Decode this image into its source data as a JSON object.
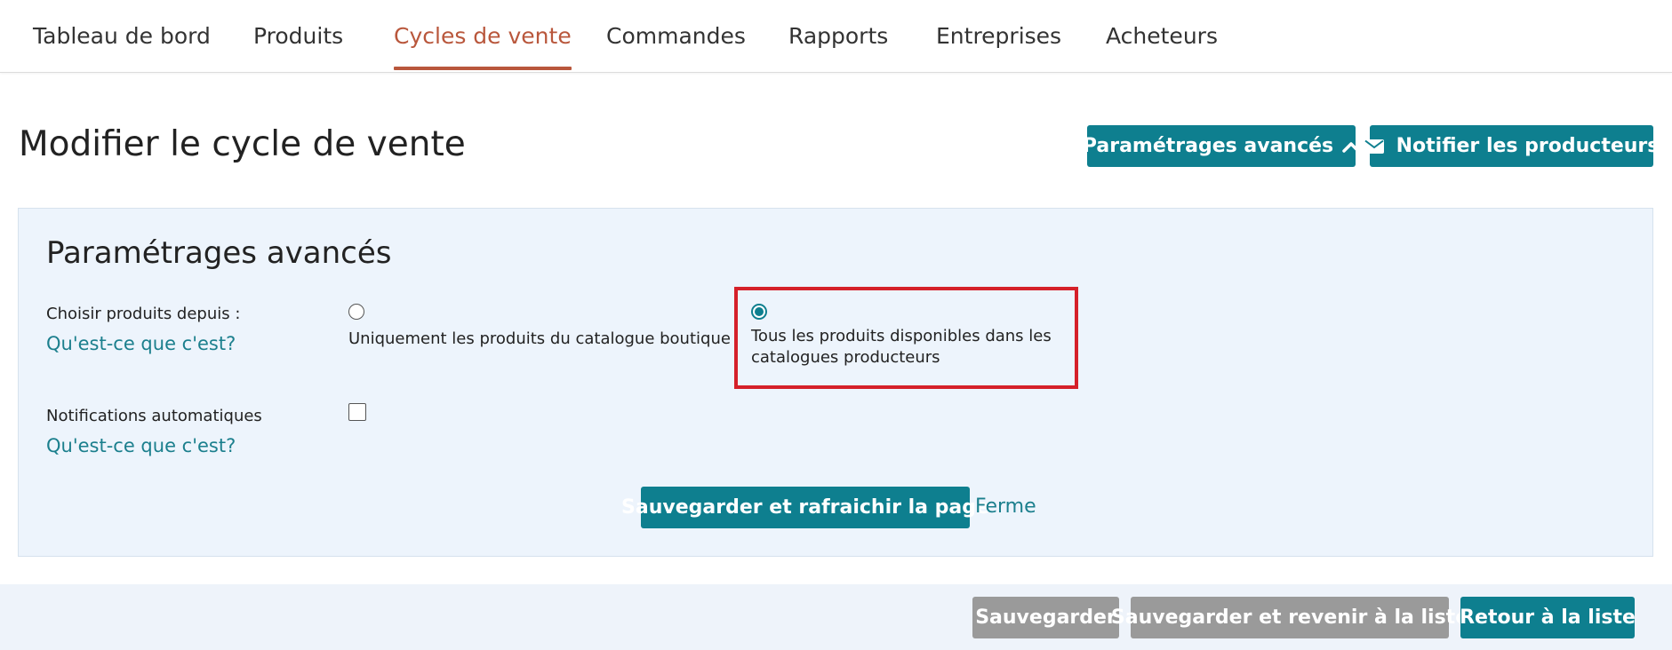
{
  "nav": {
    "tabs": [
      {
        "label": "Tableau de bord"
      },
      {
        "label": "Produits"
      },
      {
        "label": "Cycles de vente"
      },
      {
        "label": "Commandes"
      },
      {
        "label": "Rapports"
      },
      {
        "label": "Entreprises"
      },
      {
        "label": "Acheteurs"
      }
    ],
    "active_index": 2
  },
  "header": {
    "title": "Modifier le cycle de vente",
    "advanced_button": "Paramétrages avancés",
    "advanced_icon": "chevron-up-icon",
    "notify_button": "Notifier les producteurs",
    "notify_icon": "envelope-icon"
  },
  "advanced": {
    "title": "Paramétrages avancés",
    "products_from": {
      "label": "Choisir produits depuis :",
      "help": "Qu'est-ce que c'est?",
      "options": [
        {
          "label": "Uniquement les produits du catalogue boutique",
          "selected": false
        },
        {
          "label": "Tous les produits disponibles dans les catalogues producteurs",
          "selected": true
        }
      ]
    },
    "auto_notifications": {
      "label": "Notifications automatiques",
      "help": "Qu'est-ce que c'est?",
      "checked": false
    },
    "save_refresh_button": "Sauvegarder et rafraichir la page",
    "close_link": "Ferme"
  },
  "footer": {
    "save": "Sauvegarder",
    "save_and_back": "Sauvegarder et revenir à la liste",
    "back": "Retour à la liste"
  },
  "colors": {
    "accent": "#0e7f8f",
    "active_tab": "#b9573c",
    "highlight": "#d52029",
    "panel_bg": "#edf4fc",
    "disabled_button": "#9a9a9a"
  }
}
